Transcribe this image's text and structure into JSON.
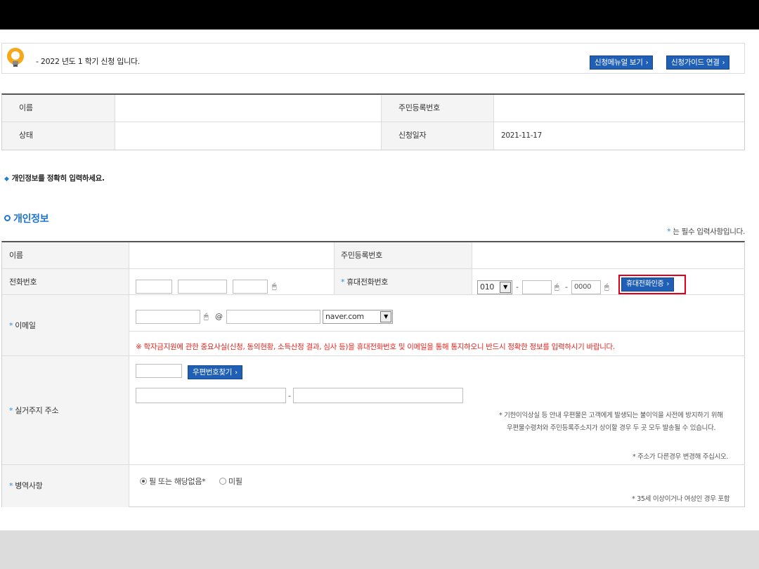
{
  "notice": {
    "text": "- 2022 년도 1 학기 신청 입니다.",
    "manual_button": "신청메뉴얼 보기",
    "guide_button": "신청가이드 연결"
  },
  "summary": {
    "name_label": "이름",
    "rrn_label": "주민등록번호",
    "status_label": "상태",
    "date_label": "신청일자",
    "date_value": "2021-11-17"
  },
  "guide_text": "개인정보를 정확히 입력하세요.",
  "section_title": "개인정보",
  "required_note": "는 필수 입력사항입니다.",
  "form": {
    "name_label": "이름",
    "rrn_label": "주민등록번호",
    "phone_label": "전화번호",
    "mobile_label": "휴대전화번호",
    "mobile_prefix": "010",
    "mobile_last": "0000",
    "mobile_verify_button": "휴대전화인증",
    "email_label": "이메일",
    "email_at": "@",
    "email_domain": "naver.com",
    "warning": "※ 학자금지원에 관한 중요사실(신청, 동의현황, 소득산정 결과, 심사 등)을 휴대전화번호 및 이메일을 통해 통지하오니 반드시 정확한 정보를 입력하시기 바랍니다.",
    "address_label": "실거주지 주소",
    "zip_button": "우편번호찾기",
    "address_dash": "-",
    "address_note_1": "* 기한이익상실 등 안내 우편물은 고객에게 발생되는 불이익을 사전에 방지하기 위해",
    "address_note_2": "우편물수령처와 주민등록주소지가 상이할 경우 두 곳 모두 발송될 수 있습니다.",
    "address_note_3": "* 주소가 다른경우 변경해 주십시오.",
    "military_label": "병역사항",
    "military_option_1": "필 또는 해당없음*",
    "military_option_2": "미필",
    "military_note": "* 35세 이상이거나 여성인 경우 포함",
    "dash": "-"
  },
  "icons": {
    "bulb": "lightbulb-icon",
    "mouse": "mouse-icon",
    "chevron": "chevron-right-icon",
    "dropdown": "chevron-down-icon"
  },
  "colors": {
    "accent_blue": "#1f5fb5",
    "title_blue": "#1c74d0",
    "warning_red": "#e8251e",
    "highlight_red": "#e0001b"
  }
}
